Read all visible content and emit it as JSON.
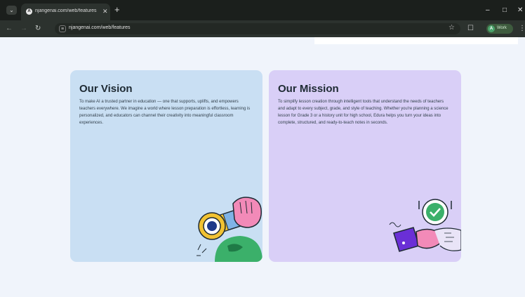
{
  "browser": {
    "tab_title": "njangenai.com/web/features",
    "tab_favicon": "A",
    "url": "njangenai.com/web/features",
    "profile_initial": "A",
    "profile_label": "Work",
    "icons": {
      "tab_menu": "chevron-down-icon",
      "tab_close": "close-icon",
      "new_tab": "plus-icon",
      "back": "arrow-left-icon",
      "forward": "arrow-right-icon",
      "reload": "reload-icon",
      "site_info": "tune-icon",
      "bookmark": "star-icon",
      "extensions": "puzzle-icon",
      "menu": "kebab-icon",
      "minimize": "minimize-icon",
      "maximize": "maximize-icon",
      "close": "close-icon"
    }
  },
  "cards": {
    "vision": {
      "title": "Our Vision",
      "body": "To make AI a trusted partner in education — one that supports, uplifts, and empowers teachers everywhere. We imagine a world where lesson preparation is effortless, learning is personalized, and educators can channel their creativity into meaningful classroom experiences.",
      "illustration": "telescope-illustration",
      "bg": "#c9dff3"
    },
    "mission": {
      "title": "Our Mission",
      "body": "To simplify lesson creation through intelligent tools that understand the needs of teachers and adapt to every subject, grade, and style of teaching. Whether you're planning a science lesson for Grade 3 or a history unit for high school, Edura helps you turn your ideas into complete, structured, and ready-to-teach notes in seconds.",
      "illustration": "handshake-illustration",
      "bg": "#d9cff7"
    }
  },
  "colors": {
    "page_bg": "#f0f4fb",
    "chrome_dark": "#1b1f1c",
    "toolbar": "#2c322e",
    "accent_green": "#3bb06a",
    "accent_purple": "#6a2fd6",
    "accent_pink": "#f06ab0"
  }
}
